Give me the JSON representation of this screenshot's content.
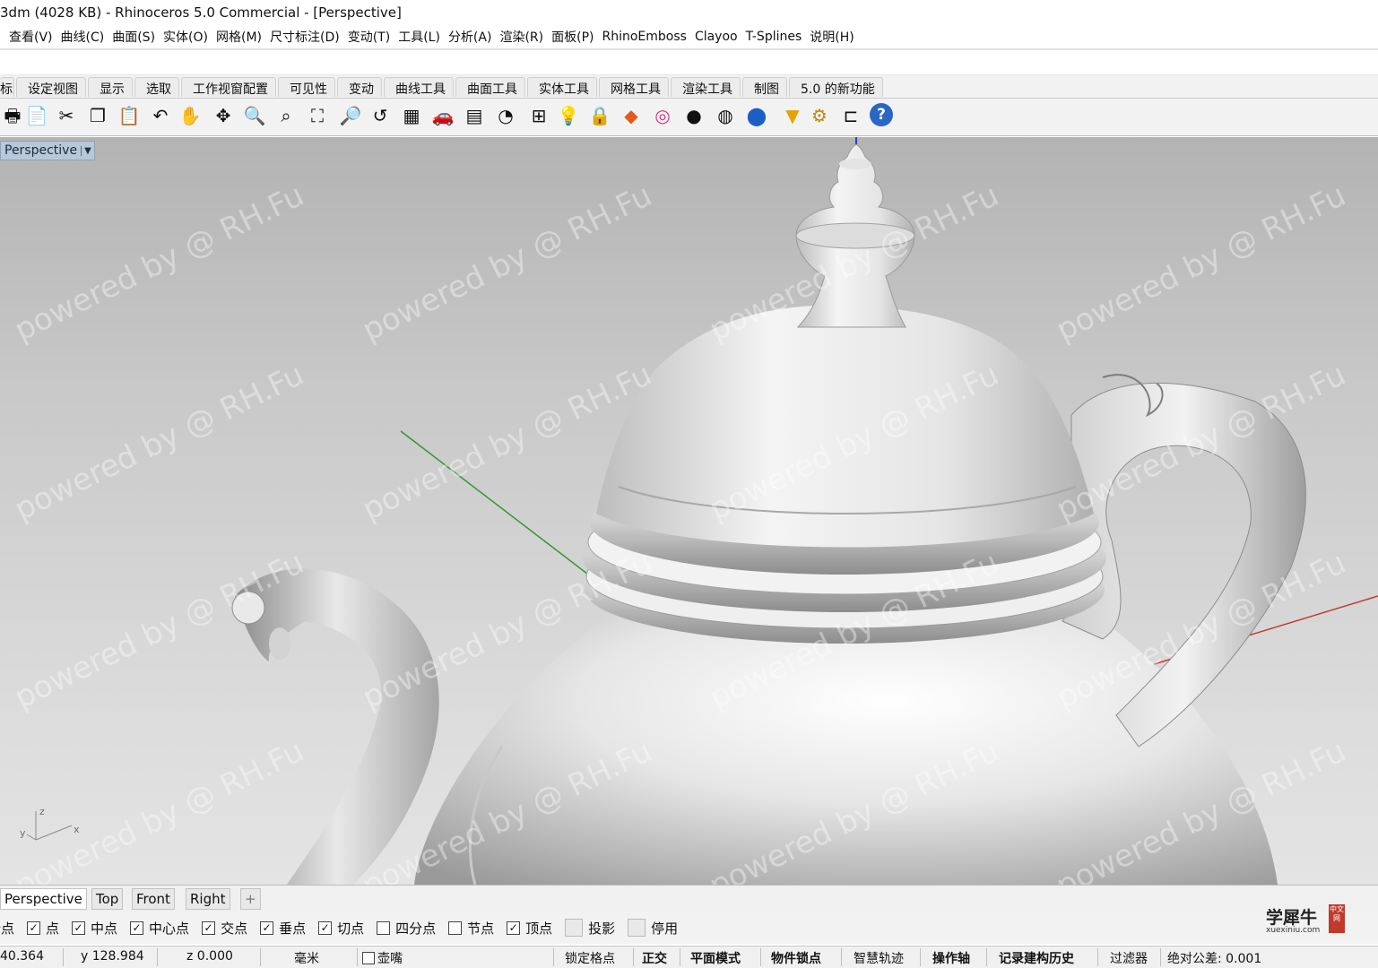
{
  "window": {
    "title": "3dm (4028 KB) - Rhinoceros 5.0 Commercial - [Perspective]"
  },
  "menu": [
    "查看(V)",
    "曲线(C)",
    "曲面(S)",
    "实体(O)",
    "网格(M)",
    "尺寸标注(D)",
    "变动(T)",
    "工具(L)",
    "分析(A)",
    "渲染(R)",
    "面板(P)",
    "RhinoEmboss",
    "Clayoo",
    "T-Splines",
    "说明(H)"
  ],
  "toolbar_tabs": [
    "标准",
    "设定视图",
    "显示",
    "选取",
    "工作视窗配置",
    "可见性",
    "变动",
    "曲线工具",
    "曲面工具",
    "实体工具",
    "网格工具",
    "渲染工具",
    "制图",
    "5.0 的新功能"
  ],
  "toolbar_icons": [
    "print-icon",
    "new-file-icon",
    "cut-icon",
    "copy-icon",
    "paste-icon",
    "undo-icon",
    "pan-hand-icon",
    "rotate-view-icon",
    "zoom-icon",
    "zoom-window-icon",
    "zoom-extents-icon",
    "zoom-selected-icon",
    "undo-view-icon",
    "viewport-layout-icon",
    "car-icon",
    "grid-icon",
    "cplane-icon",
    "snap-icon",
    "light-bulb-icon",
    "lock-icon",
    "layer-icon",
    "color-wheel-icon",
    "shaded-sphere-icon",
    "rendered-sphere-icon",
    "render-icon",
    "filter-icon",
    "options-gear-icon",
    "history-icon",
    "help-icon"
  ],
  "viewport": {
    "label": "Perspective",
    "axis_labels": {
      "z": "z",
      "y": "y",
      "x": "x"
    },
    "watermark": "powered by @ RH.Fu"
  },
  "view_tabs": [
    "Perspective",
    "Top",
    "Front",
    "Right",
    "+"
  ],
  "osnaps": [
    {
      "label": "端点",
      "checked": true
    },
    {
      "label": "点",
      "checked": true
    },
    {
      "label": "中点",
      "checked": true
    },
    {
      "label": "中心点",
      "checked": true
    },
    {
      "label": "交点",
      "checked": true
    },
    {
      "label": "垂点",
      "checked": true
    },
    {
      "label": "切点",
      "checked": true
    },
    {
      "label": "四分点",
      "checked": false
    },
    {
      "label": "节点",
      "checked": false
    },
    {
      "label": "顶点",
      "checked": true
    },
    {
      "label": "投影",
      "checked": false
    },
    {
      "label": "停用",
      "checked": false
    }
  ],
  "status": {
    "x": "40.364",
    "y": "y 128.984",
    "z": "z 0.000",
    "units": "毫米",
    "layer": "壶嘴",
    "lock_grid": "锁定格点",
    "ortho": "正交",
    "planar": "平面模式",
    "osnap": "物件锁点",
    "smarttrack": "智慧轨迹",
    "gumball": "操作轴",
    "history": "记录建构历史",
    "filter": "过滤器",
    "tolerance": "绝对公差: 0.001"
  },
  "logo": {
    "text": "学犀牛",
    "sub": "xuexiniu.com",
    "badge": "中文网"
  },
  "colors": {
    "x_axis": "#c0392b",
    "y_axis": "#2e9a2e",
    "z_axis": "#2a3fd0",
    "viewport_label_bg": "#b8c8d8"
  }
}
